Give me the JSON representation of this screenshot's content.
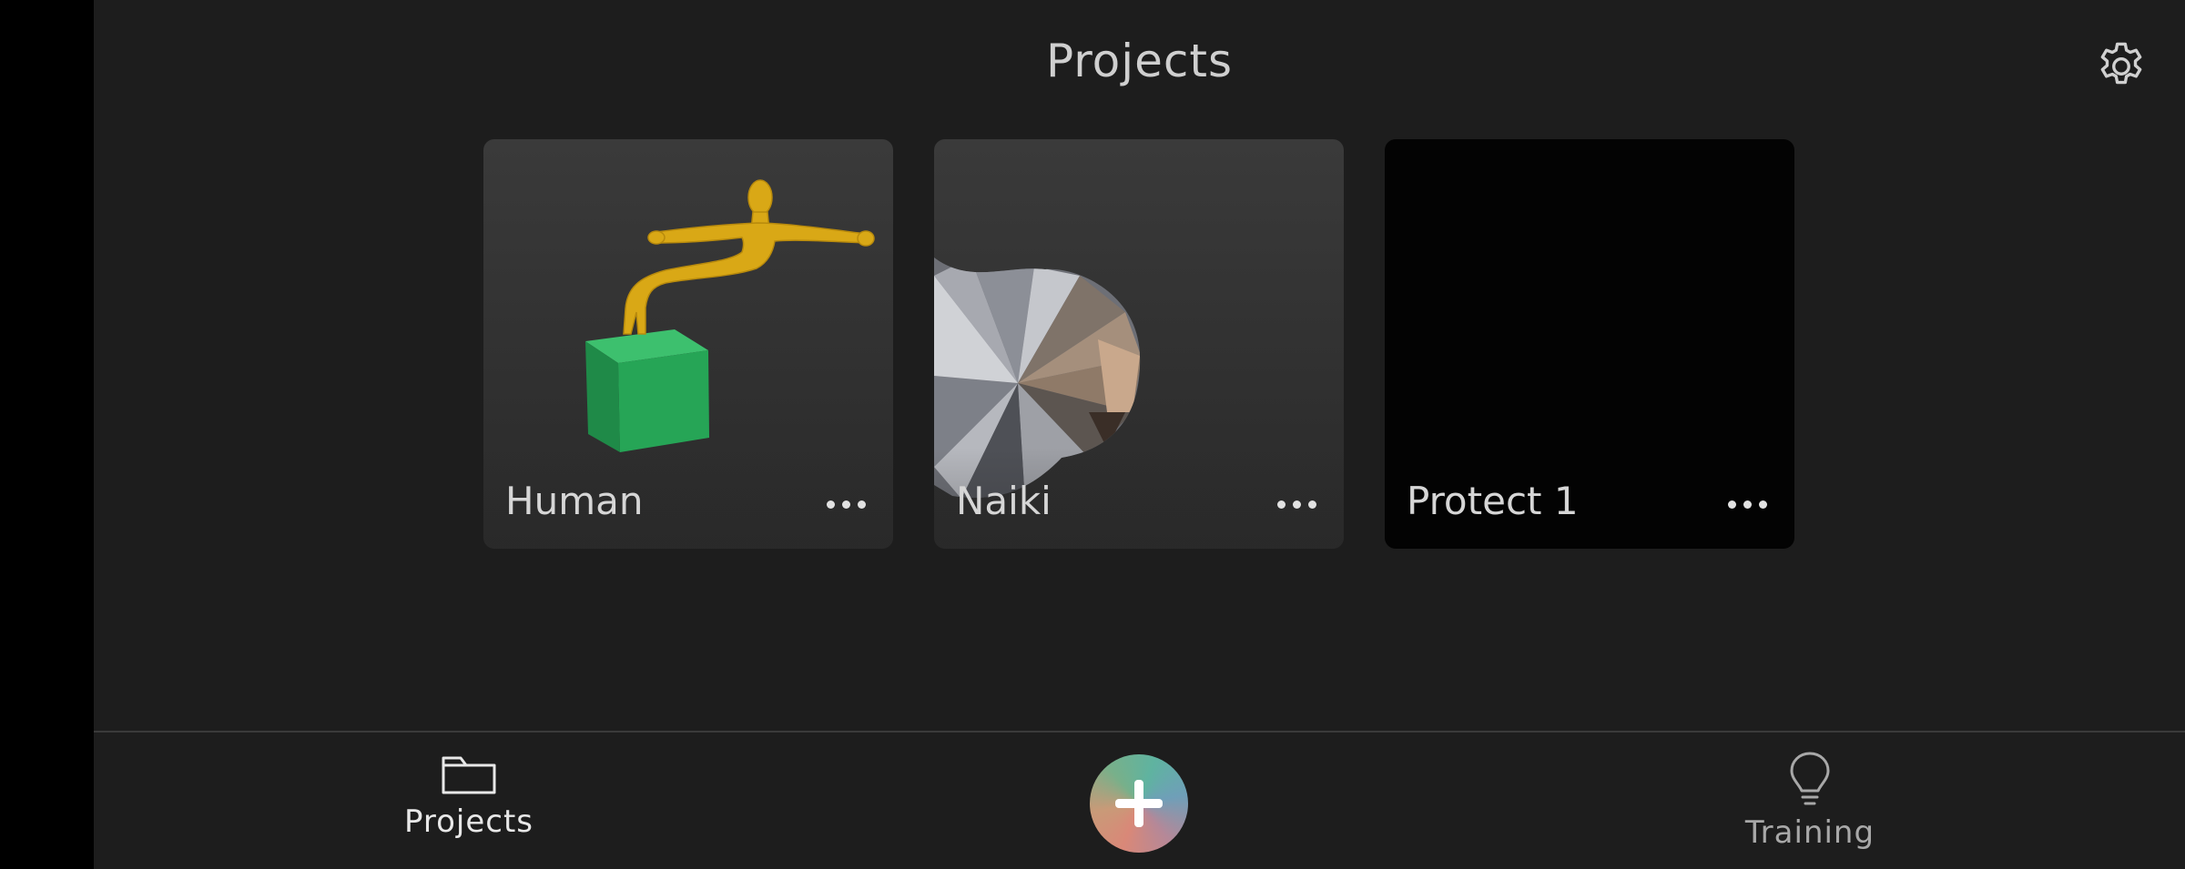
{
  "header": {
    "title": "Projects"
  },
  "projects": [
    {
      "name": "Human",
      "thumbnail": "figure-on-green-cube"
    },
    {
      "name": "Naiki",
      "thumbnail": "scanned-head-mesh"
    },
    {
      "name": "Protect 1",
      "thumbnail": "empty-black"
    }
  ],
  "bottom_nav": {
    "projects_label": "Projects",
    "training_label": "Training"
  },
  "colors": {
    "background": "#1d1d1d",
    "card": "#333333",
    "figure": "#d8a817",
    "cube": "#22a052"
  }
}
